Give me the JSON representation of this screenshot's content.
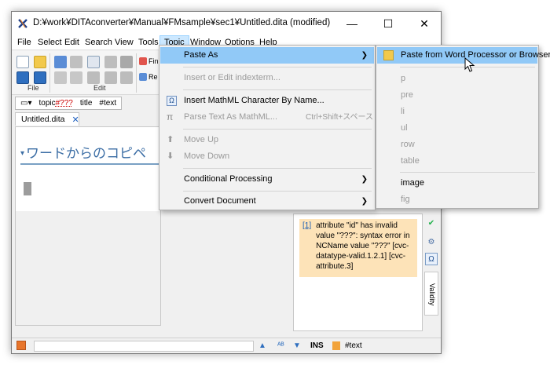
{
  "window": {
    "title": "D:¥work¥DITAconverter¥Manual¥FMsample¥sec1¥Untitled.dita (modified)",
    "minimize_glyph": "—",
    "maximize_glyph": "☐",
    "close_glyph": "✕"
  },
  "menubar": {
    "items": [
      "File",
      "Select",
      "Edit",
      "Search",
      "View",
      "Tools",
      "Topic",
      "Window",
      "Options",
      "Help"
    ],
    "active": "Topic"
  },
  "toolbar": {
    "groups": [
      "File",
      "Edit"
    ],
    "find_label": "Fin",
    "replace_label": "Re"
  },
  "breadcrumb": {
    "dropdown_glyph": "▾",
    "topic": "topic",
    "topic_error": "#???",
    "title": "title",
    "text": "#text"
  },
  "tab": {
    "label": "Untitled.dita",
    "close_glyph": "✕"
  },
  "editor": {
    "heading_marker": "▾",
    "heading_text": "ワードからのコピペ"
  },
  "validity": {
    "index": "[1]",
    "message": "attribute \"id\" has invalid value \"???\": syntax error in NCName value \"???\" [cvc-datatype-valid.1.2.1] [cvc-attribute.3]",
    "tab_label": "Validity"
  },
  "topic_menu": {
    "items": [
      {
        "label": "Paste As",
        "submenu": true,
        "highlighted": true,
        "disabled": false,
        "icon": ""
      },
      {
        "label": "Insert or Edit indexterm...",
        "disabled": true,
        "icon": ""
      },
      {
        "label": "Insert MathML Character By Name...",
        "disabled": false,
        "icon": "omega-icon"
      },
      {
        "label": "Parse Text As MathML...",
        "accelerator": "Ctrl+Shift+スペース",
        "disabled": true,
        "icon": "pi-icon"
      },
      {
        "label": "Move Up",
        "disabled": true,
        "icon": "arrow-up-icon"
      },
      {
        "label": "Move Down",
        "disabled": true,
        "icon": "arrow-down-icon"
      },
      {
        "label": "Conditional Processing",
        "submenu": true,
        "disabled": false,
        "icon": ""
      },
      {
        "label": "Convert Document",
        "submenu": true,
        "disabled": false,
        "icon": ""
      }
    ],
    "submenu_glyph": "❯"
  },
  "paste_as_menu": {
    "items": [
      {
        "label": "Paste from Word Processor or Browser",
        "highlighted": true,
        "disabled": false
      },
      {
        "label": "p",
        "disabled": true
      },
      {
        "label": "pre",
        "disabled": true
      },
      {
        "label": "li",
        "disabled": true
      },
      {
        "label": "ul",
        "disabled": true
      },
      {
        "label": "row",
        "disabled": true
      },
      {
        "label": "table",
        "disabled": true
      },
      {
        "label": "image",
        "disabled": false
      },
      {
        "label": "fig",
        "disabled": true
      }
    ]
  },
  "statusbar": {
    "mode": "INS",
    "element": "#text"
  },
  "colors": {
    "menu_highlight": "#91c9f7",
    "active_menubar": "#cce8ff",
    "heading": "#3c6ea5",
    "validity_bg": "#fde3b8"
  }
}
